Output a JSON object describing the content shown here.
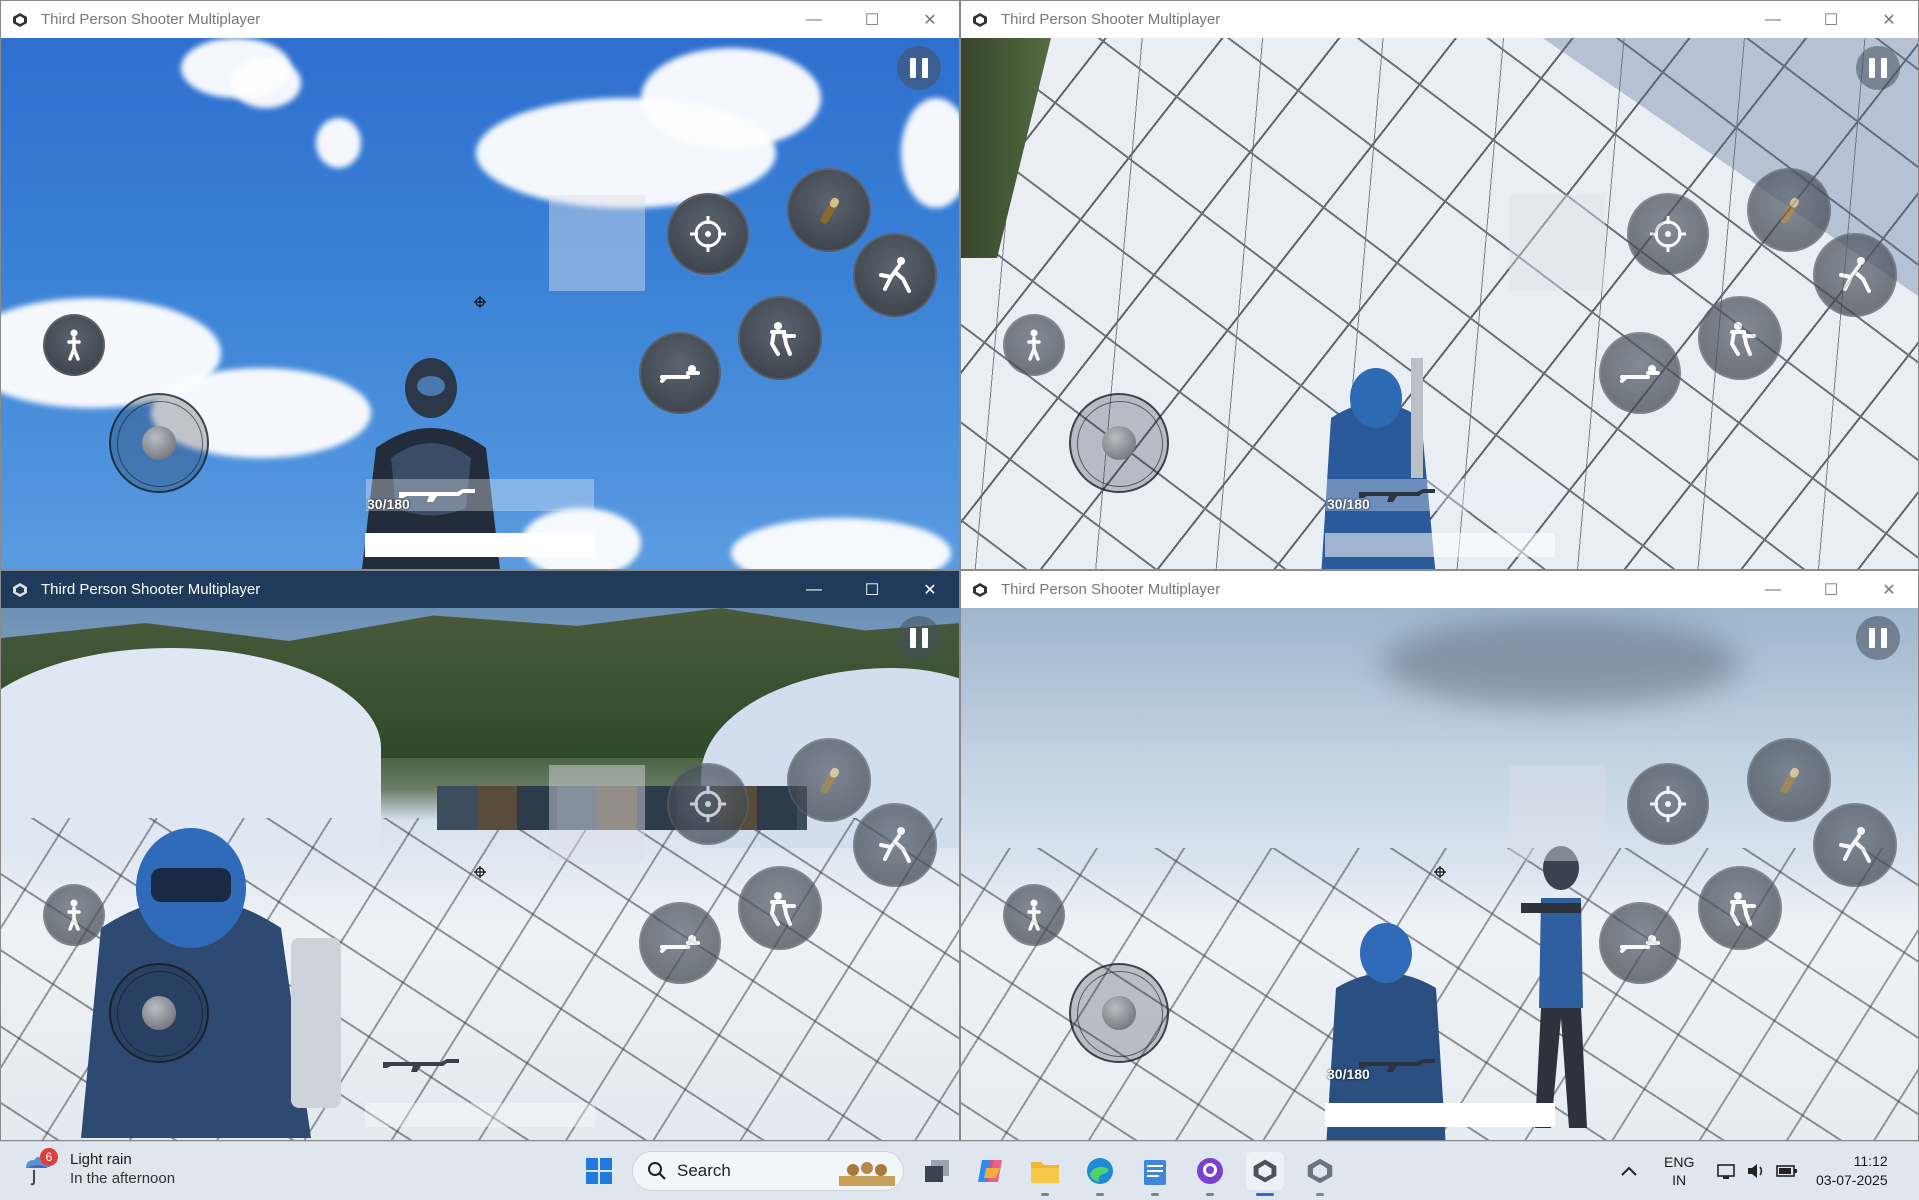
{
  "windows": [
    {
      "title": "Third Person Shooter Multiplayer",
      "ammo": "30/180",
      "state": "inactive"
    },
    {
      "title": "Third Person Shooter Multiplayer",
      "ammo": "30/180",
      "state": "inactive"
    },
    {
      "title": "Third Person Shooter Multiplayer",
      "ammo": "",
      "state": "active"
    },
    {
      "title": "Third Person Shooter Multiplayer",
      "ammo": "30/180",
      "state": "inactive"
    }
  ],
  "caption_buttons": {
    "minimize": "—",
    "maximize": "☐",
    "close": "✕"
  },
  "hud_icons": [
    "pause-icon",
    "aim-icon",
    "reload-icon",
    "jump-icon",
    "crouch-icon",
    "prone-icon",
    "walk-icon"
  ],
  "taskbar": {
    "weather": {
      "badge": "6",
      "line1": "Light rain",
      "line2": "In the afternoon"
    },
    "search_placeholder": "Search",
    "language": {
      "line1": "ENG",
      "line2": "IN"
    },
    "clock": {
      "time": "11:12",
      "date": "03-07-2025"
    }
  },
  "colors": {
    "accent": "#2d6bd0",
    "active_title": "#1f3a5a",
    "taskbar": "#dfe6ee"
  }
}
